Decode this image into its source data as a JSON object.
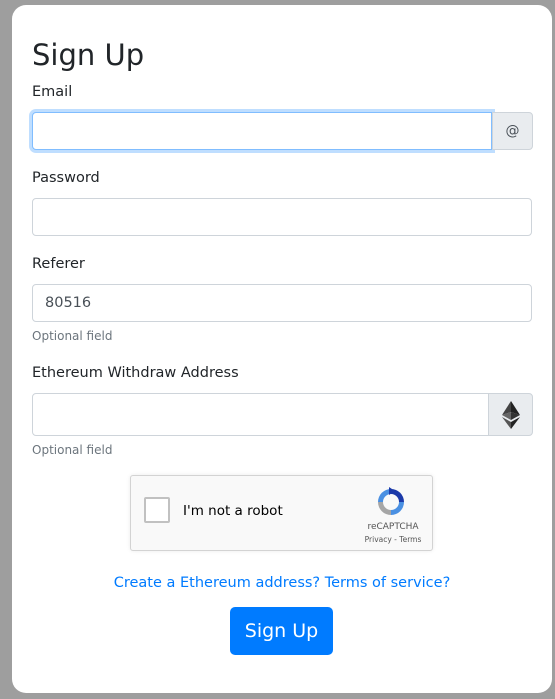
{
  "form": {
    "title": "Sign Up",
    "email": {
      "label": "Email",
      "value": "",
      "addon": "@"
    },
    "password": {
      "label": "Password",
      "value": ""
    },
    "referer": {
      "label": "Referer",
      "value": "80516",
      "help": "Optional field"
    },
    "ethereum": {
      "label": "Ethereum Withdraw Address",
      "value": "",
      "help": "Optional field",
      "addon_icon": "ethereum-icon"
    },
    "captcha": {
      "label": "I'm not a robot",
      "brand": "reCAPTCHA",
      "links": "Privacy - Terms",
      "icon": "recaptcha-logo-icon"
    },
    "link": "Create a Ethereum address? Terms of service?",
    "submit_label": "Sign Up"
  },
  "colors": {
    "primary": "#007bff",
    "focus_border": "#80bdff",
    "addon_bg": "#e9ecef",
    "page_bg": "#9e9e9e"
  }
}
